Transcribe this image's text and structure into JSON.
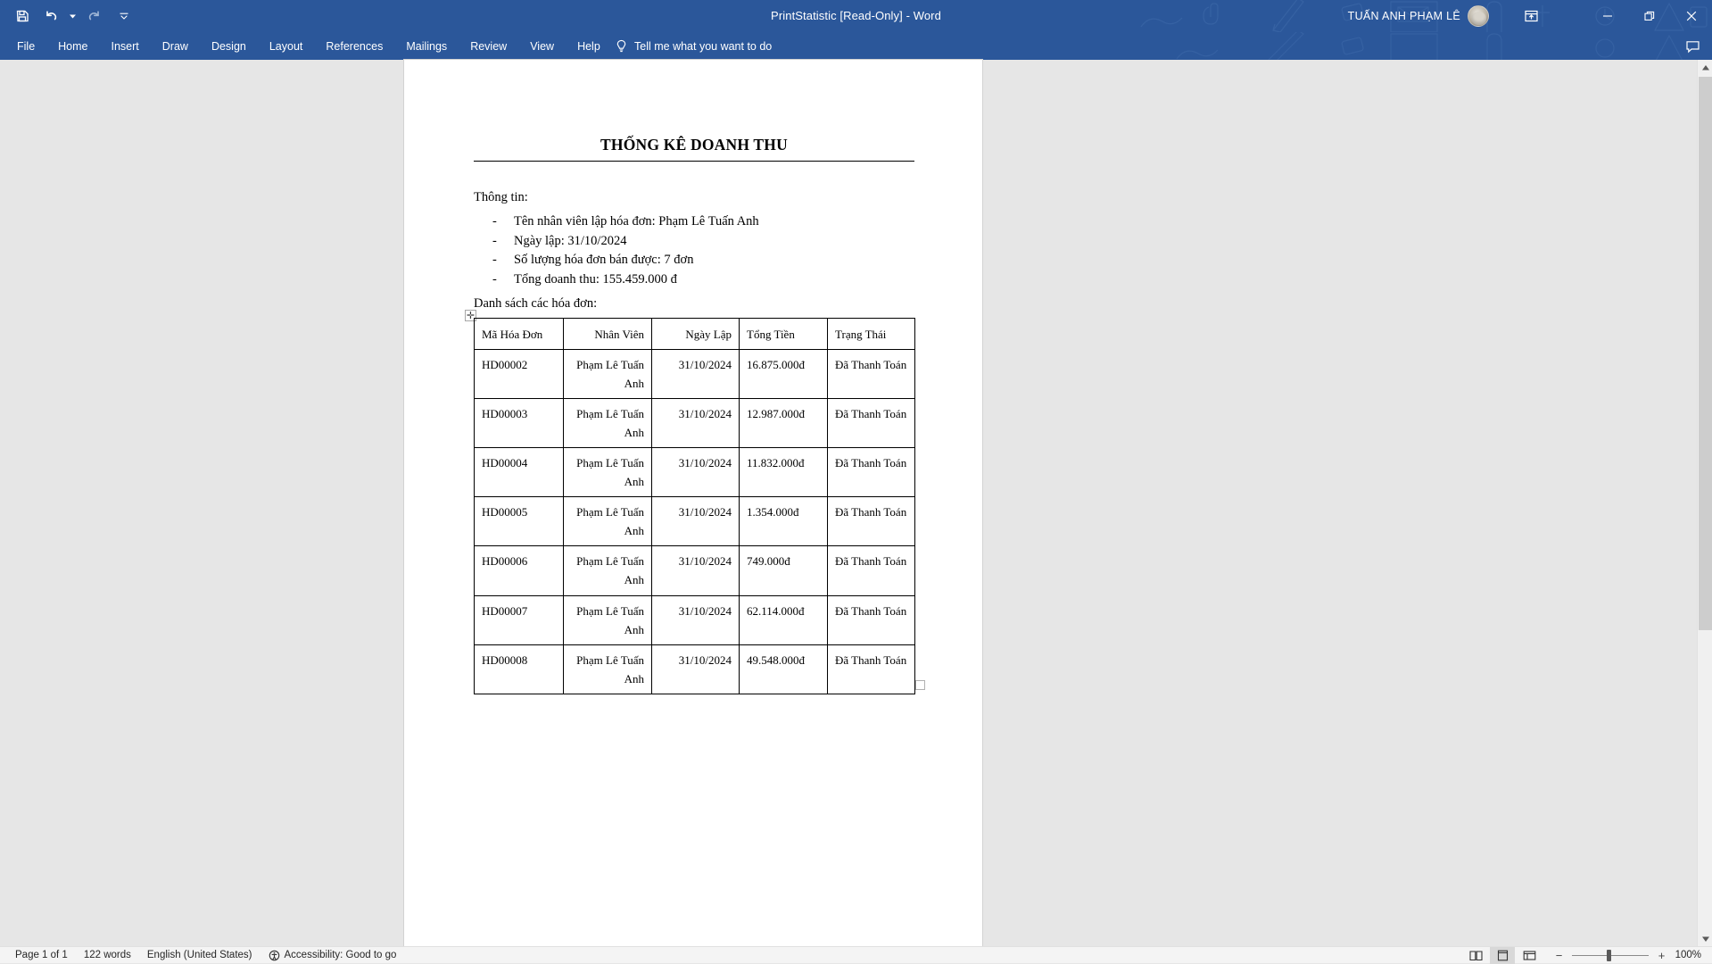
{
  "window": {
    "title": "PrintStatistic [Read-Only]  -  Word",
    "account_name": "TUẤN ANH PHẠM LÊ",
    "icons": {
      "save": "save-icon",
      "undo": "undo-icon",
      "redo": "redo-icon",
      "customize_qat": "customize-quick-access-toolbar-icon",
      "ribbon_display": "ribbon-display-options-icon",
      "minimize": "minimize-icon",
      "restore": "restore-icon",
      "close": "close-icon",
      "comments": "comments-icon"
    }
  },
  "ribbon": {
    "tabs": [
      {
        "label": "File"
      },
      {
        "label": "Home"
      },
      {
        "label": "Insert"
      },
      {
        "label": "Draw"
      },
      {
        "label": "Design"
      },
      {
        "label": "Layout"
      },
      {
        "label": "References"
      },
      {
        "label": "Mailings"
      },
      {
        "label": "Review"
      },
      {
        "label": "View"
      },
      {
        "label": "Help"
      }
    ],
    "tell_me": "Tell me what you want to do",
    "tell_me_icon": "lightbulb-icon"
  },
  "document": {
    "title": "THỐNG KÊ DOANH THU",
    "lead": "Thông tin:",
    "bullets": [
      "Tên nhân viên lập hóa đơn: Phạm Lê Tuấn Anh",
      "Ngày lập: 31/10/2024",
      "Số lượng hóa đơn bán được: 7 đơn",
      "Tổng doanh thu: 155.459.000 đ"
    ],
    "bullet_marker": "-",
    "subhead": "Danh sách các hóa đơn:",
    "table_handle_icon": "table-move-handle-icon",
    "table": {
      "headers": [
        "Mã Hóa Đơn",
        "Nhân Viên",
        "Ngày Lập",
        "Tổng Tiền",
        "Trạng Thái"
      ],
      "rows": [
        {
          "ma": "HD00002",
          "nhan_vien": "Phạm Lê Tuấn Anh",
          "ngay_lap": "31/10/2024",
          "tong_tien": "16.875.000đ",
          "trang_thai": "Đã Thanh Toán"
        },
        {
          "ma": "HD00003",
          "nhan_vien": "Phạm Lê Tuấn Anh",
          "ngay_lap": "31/10/2024",
          "tong_tien": "12.987.000đ",
          "trang_thai": "Đã Thanh Toán"
        },
        {
          "ma": "HD00004",
          "nhan_vien": "Phạm Lê Tuấn Anh",
          "ngay_lap": "31/10/2024",
          "tong_tien": "11.832.000đ",
          "trang_thai": "Đã Thanh Toán"
        },
        {
          "ma": "HD00005",
          "nhan_vien": "Phạm Lê Tuấn Anh",
          "ngay_lap": "31/10/2024",
          "tong_tien": "1.354.000đ",
          "trang_thai": "Đã Thanh Toán"
        },
        {
          "ma": "HD00006",
          "nhan_vien": "Phạm Lê Tuấn Anh",
          "ngay_lap": "31/10/2024",
          "tong_tien": "749.000đ",
          "trang_thai": "Đã Thanh Toán"
        },
        {
          "ma": "HD00007",
          "nhan_vien": "Phạm Lê Tuấn Anh",
          "ngay_lap": "31/10/2024",
          "tong_tien": "62.114.000đ",
          "trang_thai": "Đã Thanh Toán"
        },
        {
          "ma": "HD00008",
          "nhan_vien": "Phạm Lê Tuấn Anh",
          "ngay_lap": "31/10/2024",
          "tong_tien": "49.548.000đ",
          "trang_thai": "Đã Thanh Toán"
        }
      ]
    }
  },
  "status_bar": {
    "page": "Page 1 of 1",
    "words": "122 words",
    "language": "English (United States)",
    "accessibility": "Accessibility: Good to go",
    "accessibility_icon": "accessibility-icon",
    "views": [
      {
        "name": "read-mode",
        "icon": "read-mode-icon",
        "active": false
      },
      {
        "name": "print-layout",
        "icon": "print-layout-icon",
        "active": true
      },
      {
        "name": "web-layout",
        "icon": "web-layout-icon",
        "active": false
      }
    ],
    "zoom_out": "−",
    "zoom_in": "+",
    "zoom_level": "100%"
  },
  "colors": {
    "titlebar": "#2b579a",
    "page": "#ffffff",
    "workspace": "#e6e6e6",
    "statusbar": "#f4f4f4"
  }
}
